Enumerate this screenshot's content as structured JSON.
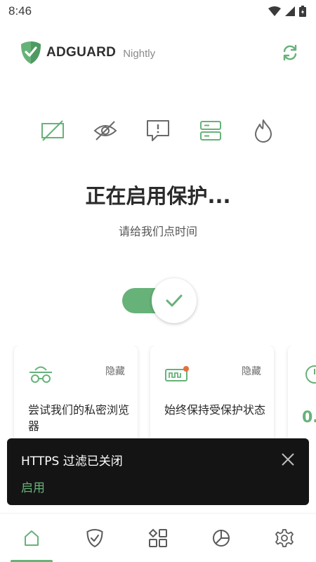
{
  "status_bar": {
    "time": "8:46"
  },
  "header": {
    "brand": "ADGUARD",
    "channel": "Nightly"
  },
  "feature_icons": [
    {
      "name": "ad-blocking-off-icon"
    },
    {
      "name": "tracking-protection-icon"
    },
    {
      "name": "annoyance-icon"
    },
    {
      "name": "dns-protection-icon"
    },
    {
      "name": "firewall-icon"
    }
  ],
  "status": {
    "title": "正在启用保护...",
    "subtitle": "请给我们点时间",
    "protection_enabled": true
  },
  "cards": [
    {
      "title": "尝试我们的私密浏览器",
      "hide_label": "隐藏"
    },
    {
      "title": "始终保持受保护状态",
      "hide_label": "隐藏"
    },
    {
      "partial_value": "0."
    }
  ],
  "snackbar": {
    "message": "HTTPS 过滤已关闭",
    "action": "启用"
  },
  "bottom_nav": [
    "home",
    "protection",
    "apps",
    "statistics",
    "settings"
  ],
  "colors": {
    "accent": "#67b279",
    "snackbar_bg": "#141414"
  }
}
